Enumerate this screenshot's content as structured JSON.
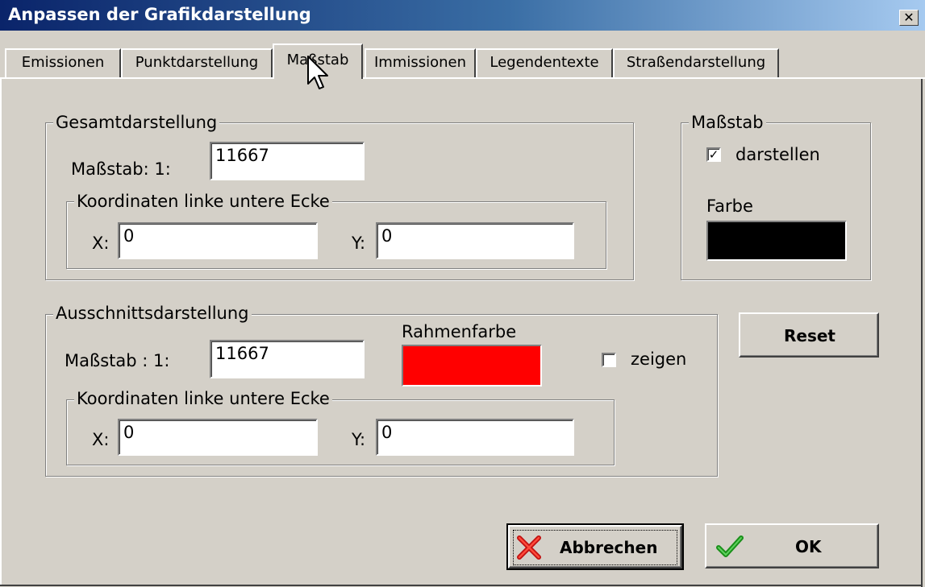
{
  "window": {
    "title": "Anpassen der Grafikdarstellung",
    "close_glyph": "✕"
  },
  "tabs": [
    {
      "label": "Emissionen",
      "active": false
    },
    {
      "label": "Punktdarstellung",
      "active": false
    },
    {
      "label": "Maßstab",
      "active": true
    },
    {
      "label": "Immissionen",
      "active": false
    },
    {
      "label": "Legendentexte",
      "active": false
    },
    {
      "label": "Straßendarstellung",
      "active": false
    }
  ],
  "gesamt": {
    "group_label": "Gesamtdarstellung",
    "scale_label": "Maßstab:  1:",
    "scale_value": "11667",
    "coords_label": "Koordinaten linke untere Ecke",
    "x_label": "X:",
    "x_value": "0",
    "y_label": "Y:",
    "y_value": "0"
  },
  "massstab": {
    "group_label": "Maßstab",
    "show_label": "darstellen",
    "show_checked": true,
    "check_glyph": "✓",
    "color_label": "Farbe",
    "color": "#000000"
  },
  "ausschnitt": {
    "group_label": "Ausschnittsdarstellung",
    "scale_label": "Maßstab :  1:",
    "scale_value": "11667",
    "frame_color_label": "Rahmenfarbe",
    "frame_color": "#ff0000",
    "show_label": "zeigen",
    "show_checked": false,
    "coords_label": "Koordinaten linke untere Ecke",
    "x_label": "X:",
    "x_value": "0",
    "y_label": "Y:",
    "y_value": "0"
  },
  "buttons": {
    "reset": "Reset",
    "cancel": "Abbrechen",
    "ok": "OK"
  },
  "icons": {
    "cancel": "red-x-icon",
    "ok": "green-check-icon",
    "cursor": "mouse-pointer-icon"
  }
}
